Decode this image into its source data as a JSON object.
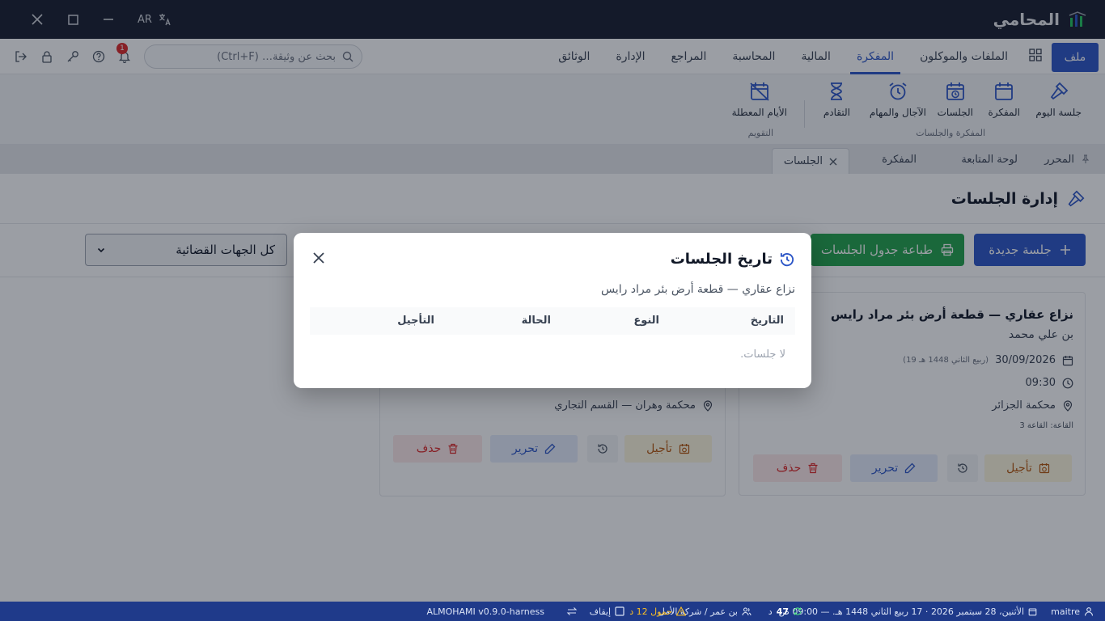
{
  "titlebar": {
    "lang": "AR",
    "app_name": "المحامي"
  },
  "menubar": {
    "file_label": "ملف",
    "items": [
      "الملفات والموكلون",
      "المفكرة",
      "المالية",
      "المحاسبة",
      "المراجع",
      "الإدارة",
      "الوثائق"
    ],
    "active_index": 1,
    "search_placeholder": "بحث عن وثيقة… (Ctrl+F)",
    "notification_count": "1"
  },
  "ribbon": {
    "items": [
      "جلسة اليوم",
      "المفكرة",
      "الجلسات",
      "الآجال والمهام",
      "التقادم",
      "الأيام المعطلة"
    ],
    "group_agenda": "المفكرة والجلسات",
    "group_calendar": "التقويم"
  },
  "tabs": {
    "items": [
      "المحرر",
      "لوحة المتابعة",
      "المفكرة",
      "الجلسات"
    ],
    "active": "الجلسات"
  },
  "page": {
    "title": "إدارة الجلسات"
  },
  "toolbar": {
    "new_label": "جلسة جديدة",
    "print_label": "طباعة جدول الجلسات",
    "court_filter": "كل الجهات القضائية"
  },
  "cards": [
    {
      "title": "نزاع عقاري — قطعة أرض بئر مراد رايس",
      "subtitle": "بن علي محمد",
      "date": "30/09/2026",
      "hijri": "(19 ربيع الثاني 1448 هـ)",
      "time": "09:30",
      "court": "محكمة الجزائر",
      "room": "القاعة: القاعة 3"
    },
    {
      "court": "محكمة وهران — القسم التجاري"
    }
  ],
  "actions": {
    "postpone": "تأجيل",
    "edit": "تحرير",
    "delete": "حذف"
  },
  "modal": {
    "title": "تاريخ الجلسات",
    "subtitle": "نزاع عقاري — قطعة أرض بئر مراد رايس",
    "columns": [
      "التاريخ",
      "النوع",
      "الحالة",
      "التأجيل"
    ],
    "empty": "لا جلسات."
  },
  "statusbar": {
    "user": "maitre",
    "datetime": "الأثنين، 28 سبتمبر 2026 · 17 ربيع الثاني 1448 هـ. — 09:00 ص",
    "sync_count": "47",
    "sync_unit": "د",
    "firm": "بن عمر / شركة الأمل",
    "load": "حمول 12 د",
    "pause": "إيقاف",
    "version": "ALMOHAMI v0.9.0-harness"
  }
}
